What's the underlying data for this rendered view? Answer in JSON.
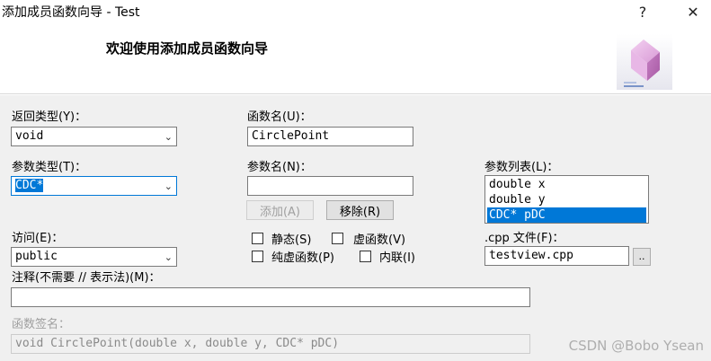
{
  "window": {
    "title": "添加成员函数向导 - Test",
    "help_glyph": "?",
    "close_glyph": "✕"
  },
  "header": {
    "welcome": "欢迎使用添加成员函数向导"
  },
  "form": {
    "return_type": {
      "label": "返回类型(Y)：",
      "value": "void"
    },
    "function_name": {
      "label": "函数名(U)：",
      "value": "CirclePoint"
    },
    "param_type": {
      "label": "参数类型(T)：",
      "value": "CDC*"
    },
    "param_name": {
      "label": "参数名(N)：",
      "value": ""
    },
    "param_list": {
      "label": "参数列表(L)：",
      "items": [
        "double x",
        "double y",
        "CDC* pDC"
      ],
      "selected_index": 2
    },
    "add_button": "添加(A)",
    "remove_button": "移除(R)",
    "access": {
      "label": "访问(E)：",
      "value": "public"
    },
    "checkboxes": {
      "static": "静态(S)",
      "virtual": "虚函数(V)",
      "pure_virtual": "纯虚函数(P)",
      "inline": "内联(I)"
    },
    "cpp_file": {
      "label": ".cpp 文件(F)：",
      "value": "testview.cpp",
      "browse": ".."
    },
    "comment": {
      "label": "注释(不需要 // 表示法)(M)：",
      "value": ""
    },
    "signature": {
      "label": "函数签名：",
      "value": "void CirclePoint(double x, double y, CDC* pDC)"
    }
  },
  "watermark": "CSDN @Bobo Ysean",
  "colors": {
    "selection": "#0078d7",
    "panel": "#f0f0f0",
    "logo_cube": "#d9a0d8"
  }
}
